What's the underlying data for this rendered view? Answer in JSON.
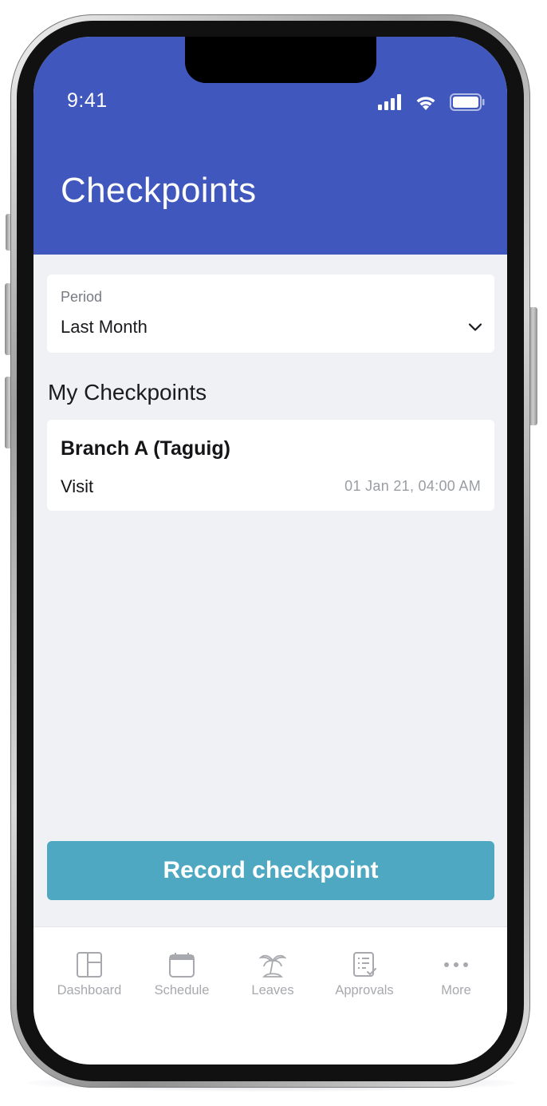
{
  "status_bar": {
    "time": "9:41",
    "icons": [
      "signal-icon",
      "wifi-icon",
      "battery-icon"
    ]
  },
  "header": {
    "title": "Checkpoints"
  },
  "period": {
    "label": "Period",
    "value": "Last Month"
  },
  "section": {
    "title": "My Checkpoints"
  },
  "checkpoints": [
    {
      "name": "Branch A (Taguig)",
      "type": "Visit",
      "timestamp": "01 Jan 21, 04:00 AM"
    }
  ],
  "actions": {
    "record_label": "Record checkpoint"
  },
  "nav": {
    "items": [
      {
        "label": "Dashboard",
        "icon": "dashboard-icon"
      },
      {
        "label": "Schedule",
        "icon": "calendar-icon"
      },
      {
        "label": "Leaves",
        "icon": "palm-tree-icon"
      },
      {
        "label": "Approvals",
        "icon": "checklist-icon"
      },
      {
        "label": "More",
        "icon": "more-dots-icon"
      }
    ]
  },
  "colors": {
    "header": "#4057bd",
    "background": "#f0f1f5",
    "button": "#4ea8c1",
    "nav_inactive": "#a7a9ae"
  }
}
